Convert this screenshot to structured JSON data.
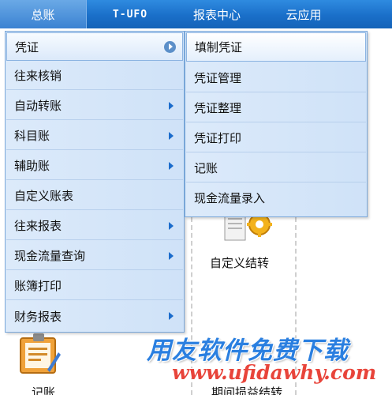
{
  "menubar": {
    "items": [
      {
        "label": "总账"
      },
      {
        "label": "T-UFO"
      },
      {
        "label": "报表中心"
      },
      {
        "label": "云应用"
      }
    ]
  },
  "menu": {
    "items": [
      {
        "label": "凭证"
      },
      {
        "label": "往来核销"
      },
      {
        "label": "自动转账"
      },
      {
        "label": "科目账"
      },
      {
        "label": "辅助账"
      },
      {
        "label": "自定义账表"
      },
      {
        "label": "往来报表"
      },
      {
        "label": "现金流量查询"
      },
      {
        "label": "账簿打印"
      },
      {
        "label": "财务报表"
      }
    ]
  },
  "submenu": {
    "items": [
      {
        "label": "填制凭证"
      },
      {
        "label": "凭证管理"
      },
      {
        "label": "凭证整理"
      },
      {
        "label": "凭证打印"
      },
      {
        "label": "记账"
      },
      {
        "label": "现金流量录入"
      }
    ]
  },
  "background": {
    "custom_close_label": "自定义结转",
    "bottom_left_label": "记账",
    "bottom_mid_label": "期间损益结转"
  },
  "watermark": {
    "text": "用友软件免费下载",
    "url": "www.ufidawhy.com"
  },
  "colors": {
    "menubar": "#1a6fc9",
    "menu_bg": "#d6e6f9",
    "watermark_blue": "#2a7fe0",
    "watermark_red": "#e8443a"
  }
}
